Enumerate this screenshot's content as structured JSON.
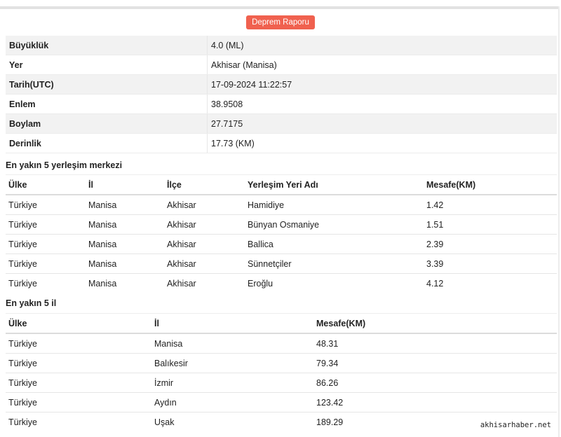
{
  "report_button": "Deprem Raporu",
  "info": [
    {
      "label": "Büyüklük",
      "value": "4.0 (ML)"
    },
    {
      "label": "Yer",
      "value": "Akhisar (Manisa)"
    },
    {
      "label": "Tarih(UTC)",
      "value": "17-09-2024 11:22:57"
    },
    {
      "label": "Enlem",
      "value": "38.9508"
    },
    {
      "label": "Boylam",
      "value": "27.7175"
    },
    {
      "label": "Derinlik",
      "value": "17.73 (KM)"
    }
  ],
  "settlements": {
    "title": "En yakın 5 yerleşim merkezi",
    "headers": [
      "Ülke",
      "İl",
      "İlçe",
      "Yerleşim Yeri Adı",
      "Mesafe(KM)"
    ],
    "rows": [
      [
        "Türkiye",
        "Manisa",
        "Akhisar",
        "Hamidiye",
        "1.42"
      ],
      [
        "Türkiye",
        "Manisa",
        "Akhisar",
        "Bünyan Osmaniye",
        "1.51"
      ],
      [
        "Türkiye",
        "Manisa",
        "Akhisar",
        "Ballica",
        "2.39"
      ],
      [
        "Türkiye",
        "Manisa",
        "Akhisar",
        "Sünnetçiler",
        "3.39"
      ],
      [
        "Türkiye",
        "Manisa",
        "Akhisar",
        "Eroğlu",
        "4.12"
      ]
    ]
  },
  "provinces": {
    "title": "En yakın 5 il",
    "headers": [
      "Ülke",
      "İl",
      "Mesafe(KM)"
    ],
    "rows": [
      [
        "Türkiye",
        "Manisa",
        "48.31"
      ],
      [
        "Türkiye",
        "Balıkesir",
        "79.34"
      ],
      [
        "Türkiye",
        "İzmir",
        "86.26"
      ],
      [
        "Türkiye",
        "Aydın",
        "123.42"
      ],
      [
        "Türkiye",
        "Uşak",
        "189.29"
      ]
    ]
  },
  "watermark": "akhisarhaber.net"
}
